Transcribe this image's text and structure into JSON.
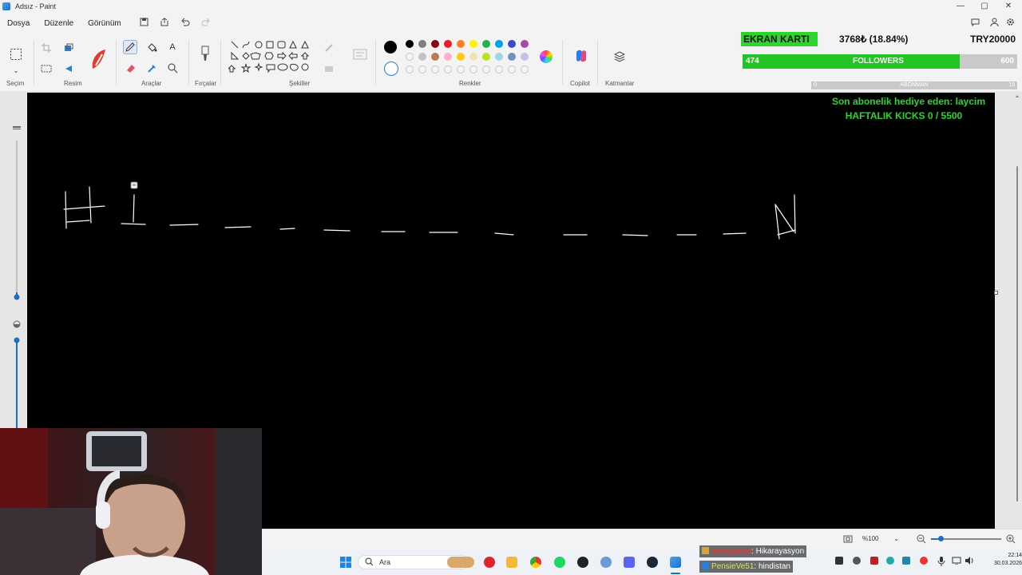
{
  "window": {
    "title": "Adsız - Paint",
    "controls": [
      "—",
      "▢",
      "✕"
    ]
  },
  "menu": {
    "items": [
      "Dosya",
      "Düzenle",
      "Görünüm"
    ]
  },
  "ribbon": {
    "groups": {
      "selection": "Seçim",
      "image": "Resim",
      "tools": "Araçlar",
      "brushes": "Fırçalar",
      "shapes": "Şekiller",
      "colors": "Renkler",
      "copilot": "Copilot",
      "layers": "Katmanlar"
    },
    "tool_text": "A",
    "palette": {
      "row1": [
        "#000000",
        "#7f7f7f",
        "#880015",
        "#ed1c24",
        "#ff7f27",
        "#fff200",
        "#22b14c",
        "#00a2e8",
        "#3f48cc",
        "#a349a4"
      ],
      "row2": [
        "",
        "#c3c3c3",
        "#b97a57",
        "#ffaec9",
        "#ffc90e",
        "#efe4b0",
        "#b5e61d",
        "#99d9ea",
        "#7092be",
        "#c8bfe7"
      ],
      "active_color": "#000000"
    }
  },
  "overlay": {
    "ekran_label": "EKRAN KARTI",
    "ekran_stat": "3768₺ (18.84%)",
    "ekran_goal": "TRY20000",
    "ekran_progress": 0.1884,
    "followers_label": "FOLLOWERS",
    "followers_current": "474",
    "followers_goal": "600",
    "followers_progress": 0.79,
    "abone_label": "ABONMAN",
    "abone_min": "0",
    "abone_max": "15",
    "sub_gift": "Son abonelik hediye eden: laycim",
    "weekly_kicks": "HAFTALIK KICKS 0 / 5500"
  },
  "drawing": {
    "letters": [
      "H",
      "I",
      "N"
    ]
  },
  "statusbar": {
    "zoom": "%100",
    "zoom_level": 1.0
  },
  "taskbar": {
    "search_placeholder": "Ara",
    "time": "22:14",
    "date": "30.03.2026"
  },
  "chat": [
    {
      "user": "mertyzeon",
      "message": ": Hikarayasyon"
    },
    {
      "user": "PensieVe51",
      "message": ": hindistan"
    }
  ]
}
